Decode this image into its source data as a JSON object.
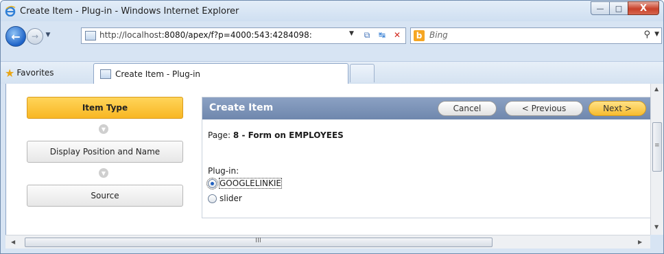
{
  "window": {
    "title": "Create Item - Plug-in - Windows Internet Explorer",
    "minimize_glyph": "—",
    "maximize_glyph": "□",
    "close_glyph": "X"
  },
  "toolbar": {
    "back_glyph": "←",
    "forward_glyph": "→",
    "dropdown_glyph": "▼",
    "address_host": "http://localhost",
    "address_rest": ":8080/apex/f?p=4000:543:4284098:",
    "compat_glyph": "⧉",
    "refresh_glyph": "↹",
    "stop_glyph": "✕",
    "search_placeholder": "Bing",
    "bing_glyph": "b",
    "search_glyph": "⚲"
  },
  "favorites": {
    "label": "Favorites",
    "star_glyph": "★"
  },
  "tabs": [
    {
      "label": "Create Item - Plug-in"
    }
  ],
  "wizard": {
    "steps": [
      {
        "label": "Item Type",
        "active": true
      },
      {
        "label": "Display Position and Name",
        "active": false
      },
      {
        "label": "Source",
        "active": false
      }
    ],
    "connector_glyph": "▼"
  },
  "region": {
    "title": "Create Item",
    "buttons": {
      "cancel": "Cancel",
      "previous": "< Previous",
      "next": "Next >"
    },
    "page_label": "Page:",
    "page_value": "8 - Form on EMPLOYEES",
    "plugin_label": "Plug-in:",
    "options": [
      {
        "label": "GOOGLELINKIE",
        "selected": true
      },
      {
        "label": "slider",
        "selected": false
      }
    ]
  },
  "scrollbars": {
    "up_glyph": "▲",
    "down_glyph": "▼",
    "left_glyph": "◀",
    "right_glyph": "▶",
    "grip_glyph": "III",
    "vgrip_glyph": "≡"
  }
}
